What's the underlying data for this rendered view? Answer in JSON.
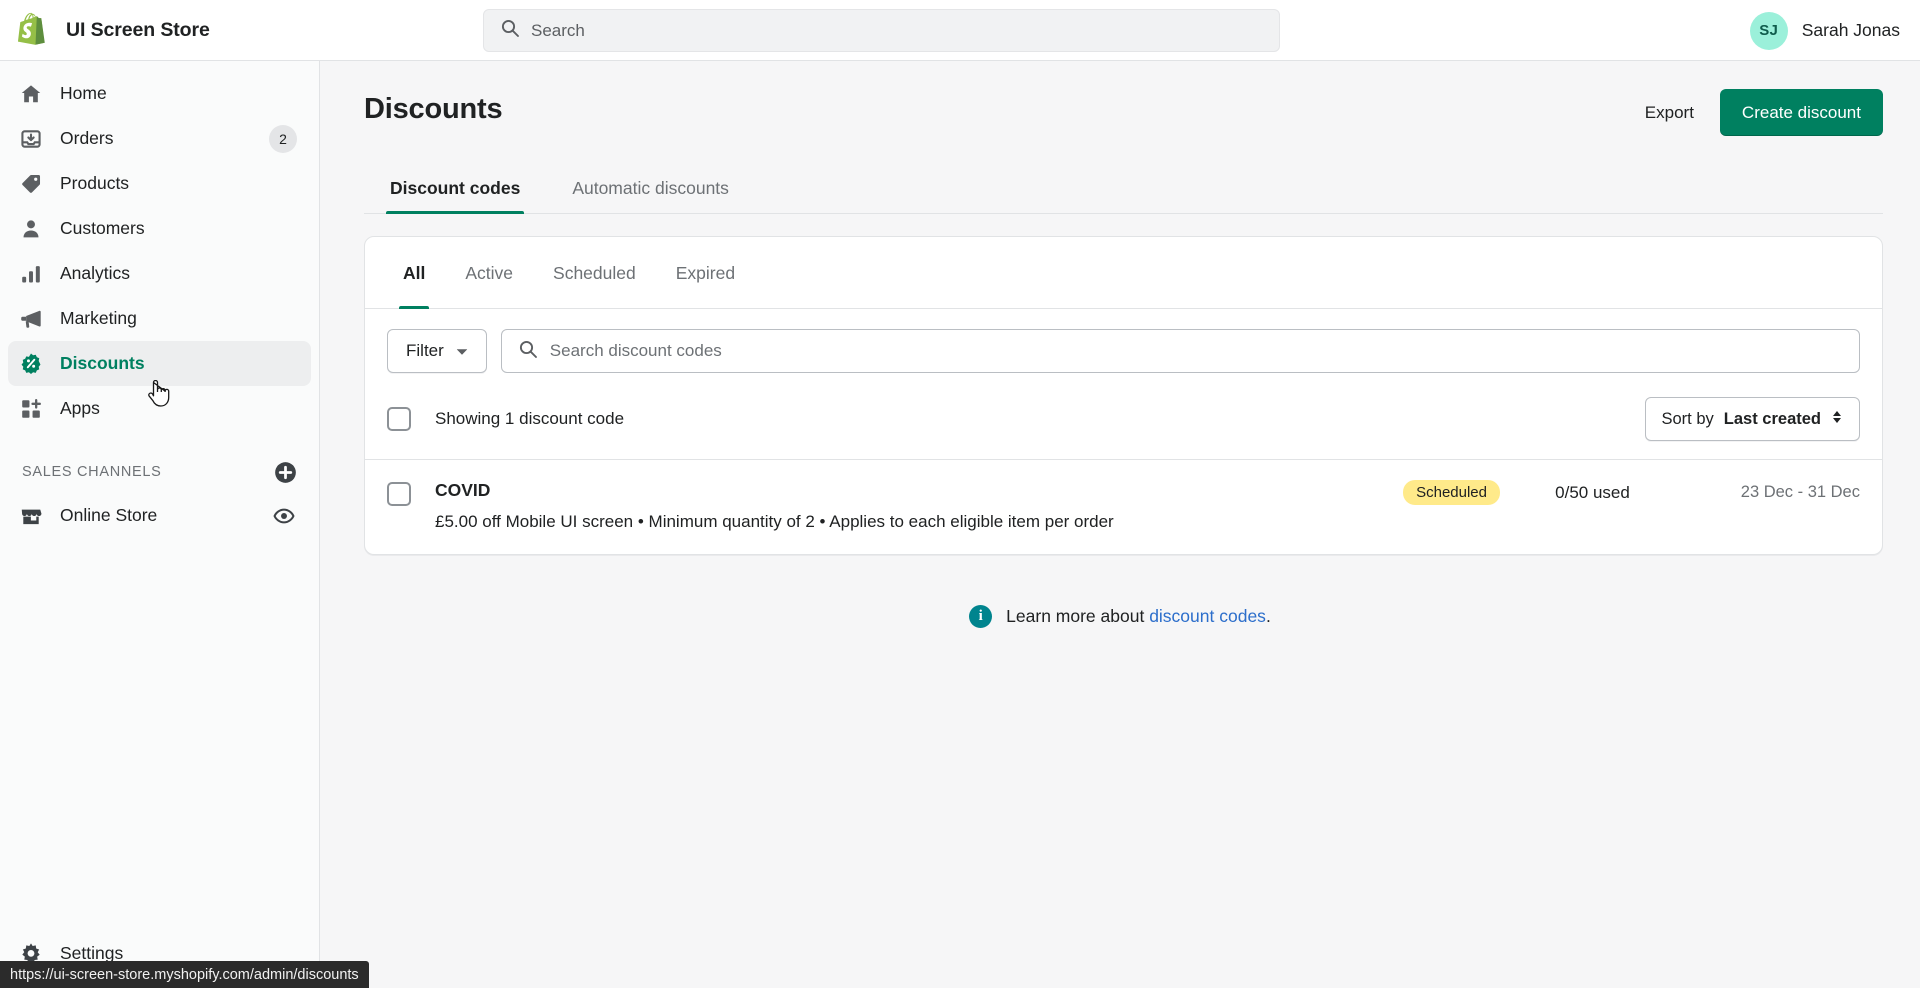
{
  "topbar": {
    "brand_name": "UI Screen Store",
    "logo_icon": "shopify-bag-icon",
    "search": {
      "placeholder": "Search",
      "value": "",
      "icon": "search-icon"
    },
    "user": {
      "initials": "SJ",
      "name": "Sarah Jonas"
    }
  },
  "sidebar": {
    "items": [
      {
        "label": "Home",
        "icon": "home-icon",
        "badge": "",
        "active": false
      },
      {
        "label": "Orders",
        "icon": "orders-inbox-icon",
        "badge": "2",
        "active": false
      },
      {
        "label": "Products",
        "icon": "product-tag-icon",
        "badge": "",
        "active": false
      },
      {
        "label": "Customers",
        "icon": "customer-person-icon",
        "badge": "",
        "active": false
      },
      {
        "label": "Analytics",
        "icon": "analytics-bars-icon",
        "badge": "",
        "active": false
      },
      {
        "label": "Marketing",
        "icon": "marketing-megaphone-icon",
        "badge": "",
        "active": false
      },
      {
        "label": "Discounts",
        "icon": "discount-percent-badge-icon",
        "badge": "",
        "active": true
      },
      {
        "label": "Apps",
        "icon": "apps-grid-plus-icon",
        "badge": "",
        "active": false
      }
    ],
    "section": {
      "title": "SALES CHANNELS",
      "add_icon": "plus-circle-icon",
      "channels": [
        {
          "label": "Online Store",
          "icon": "storefront-icon",
          "action_icon": "eye-icon"
        }
      ]
    },
    "settings": {
      "label": "Settings",
      "icon": "gear-icon"
    }
  },
  "page": {
    "title": "Discounts",
    "export_label": "Export",
    "create_label": "Create discount",
    "top_tabs": [
      {
        "label": "Discount codes",
        "active": true
      },
      {
        "label": "Automatic discounts",
        "active": false
      }
    ]
  },
  "card": {
    "tabs": [
      {
        "label": "All",
        "active": true
      },
      {
        "label": "Active",
        "active": false
      },
      {
        "label": "Scheduled",
        "active": false
      },
      {
        "label": "Expired",
        "active": false
      }
    ],
    "filter_label": "Filter",
    "filter_caret_icon": "chevron-down-icon",
    "search": {
      "placeholder": "Search discount codes",
      "value": "",
      "icon": "search-icon"
    },
    "showing_text": "Showing 1 discount code",
    "sort": {
      "prefix": "Sort by ",
      "value": "Last created",
      "icon": "sort-updown-icon"
    },
    "rows": [
      {
        "code": "COVID",
        "description": "£5.00 off Mobile UI screen • Minimum quantity of 2 • Applies to each eligible item per order",
        "status": "Scheduled",
        "status_color": "#ffea8a",
        "used": "0/50 used",
        "dates": "23 Dec - 31 Dec"
      }
    ]
  },
  "footer": {
    "info_icon": "info-icon",
    "learn_prefix": "Learn more about ",
    "learn_link": "discount codes",
    "learn_suffix": "."
  },
  "statusbar": {
    "url": "https://ui-screen-store.myshopify.com/admin/discounts"
  },
  "colors": {
    "accent_green": "#008060",
    "link_blue": "#2c6ecb",
    "badge_yellow": "#ffea8a",
    "info_teal": "#00848e",
    "avatar_mint": "#9bf0da"
  }
}
